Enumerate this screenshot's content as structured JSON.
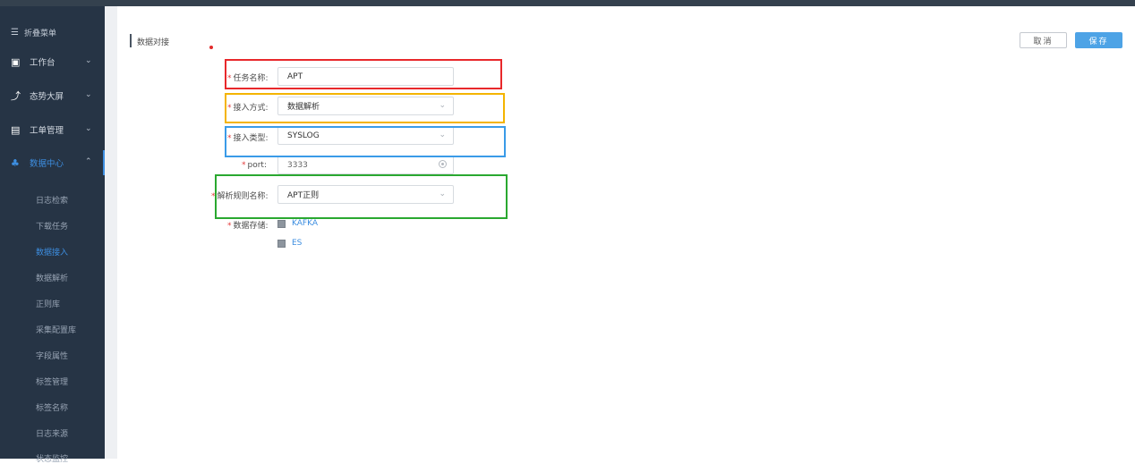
{
  "sidebar": {
    "toggle_label": "折叠菜单",
    "items": [
      {
        "label": "工作台"
      },
      {
        "label": "态势大屏"
      },
      {
        "label": "工单管理"
      },
      {
        "label": "数据中心"
      }
    ],
    "sub_items": [
      "日志检索",
      "下载任务",
      "数据接入",
      "数据解析",
      "正则库",
      "采集配置库",
      "字段属性",
      "标签管理",
      "标签名称",
      "日志来源",
      "状态监控"
    ],
    "current_sub_item": "数据接入"
  },
  "page": {
    "title": "数据对接",
    "cancel_label": "取消",
    "save_label": "保存"
  },
  "form": {
    "task_name_label": "任务名称:",
    "task_name_value": "APT",
    "access_method_label": "接入方式:",
    "access_method_value": "数据解析",
    "access_type_label": "接入类型:",
    "access_type_value": "SYSLOG",
    "port_label": "port:",
    "port_value": "3333",
    "rule_name_label": "解析规则名称:",
    "rule_name_value": "APT正则",
    "storage_label": "数据存储:",
    "storage_options": [
      "KAFKA",
      "ES"
    ]
  },
  "colors": {
    "accent": "#3d8ee0",
    "sidebar_bg": "#263445",
    "highlight_red": "#e8282b",
    "highlight_yellow": "#f4b400",
    "highlight_blue": "#3a9be8",
    "highlight_green": "#2aa830"
  }
}
